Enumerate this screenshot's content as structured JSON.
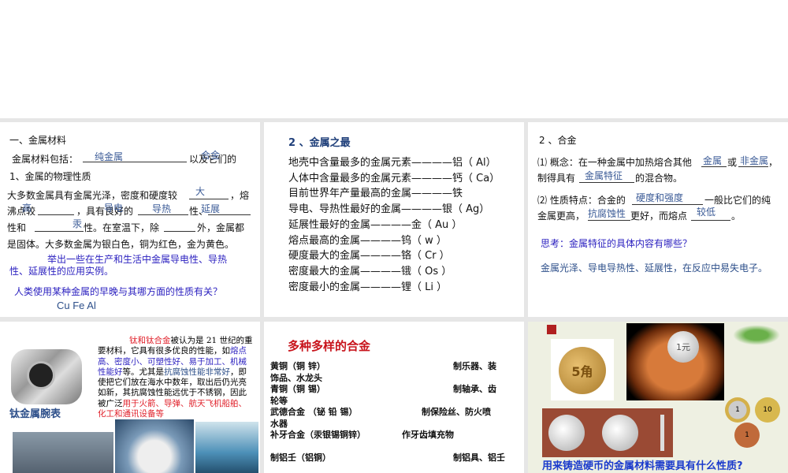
{
  "panel1": {
    "heading": "一、金属材料",
    "line1": "金属材料包括：",
    "line1_end": "以及它们的",
    "ans_pure": "纯金属",
    "ans_alloy": "合金",
    "sub": "1、金属的物理性质",
    "p1": "大多数金属具有金属光泽，密度和硬度较",
    "p1_end": "，熔",
    "p2a": "沸点较",
    "p2b": "，具有良好的",
    "p2c": "性、",
    "p3a": "性和",
    "p3b": "性。在室温下，除",
    "p3c": "外，金属都",
    "p4": "是固体。大多数金属为银白色，铜为红色，金为黄色。",
    "ans_big": "大",
    "ans_high": "高",
    "ans_elec": "导电",
    "ans_heat": "导热",
    "ans_duct": "延展",
    "ans_hg": "汞",
    "q1a": "举出一些在生产和生活中金属导电性、导热",
    "q1b": "性、延展性的应用实例。",
    "q2": "人类使用某种金属的早晚与其哪方面的性质有关？",
    "metals": "Cu   Fe   Al"
  },
  "panel2": {
    "heading": "2 、金属之最",
    "items": [
      "地壳中含量最多的金属元素————铝（ Al）",
      "人体中含量最多的金属元素————钙（ Ca）",
      "目前世界年产量最高的金属————铁",
      "导电、导热性最好的金属————银（ Ag）",
      "延展性最好的金属————金（ Au ）",
      "熔点最高的金属————钨（ w ）",
      "硬度最大的金属————铬（ Cr ）",
      "密度最大的金属————锇（ Os ）",
      "密度最小的金属————锂（ Li ）"
    ]
  },
  "panel3": {
    "heading": "2 、合金",
    "c1a": "⑴ 概念：在一种金属中加热熔合其他",
    "c1b": "或",
    "c1c": "，",
    "c2a": "制得具有",
    "c2b": "的混合物。",
    "ans_metal": "金属",
    "ans_nonmetal": "非金属",
    "ans_feature": "金属特征",
    "p1a": "⑵ 性质特点：合金的",
    "p1b": "一般比它们的纯",
    "p2a": "金属更高，",
    "p2b": "更好，而熔点",
    "p2c": "。",
    "ans_hard": "硬度和强度",
    "ans_corr": "抗腐蚀性",
    "ans_low": "较低",
    "think": "思考：金属特征的具体内容有哪些？",
    "answer": "金属光泽、导电导热性、延展性，在反应中易失电子。"
  },
  "panel4": {
    "caption": "钛金属腕表",
    "t_red1": "钛和钛合金",
    "t1": "被认为是 21 世纪的重",
    "t2": "要材料，它具有很多优良的性能，如",
    "t_blue1": "熔点",
    "t_blue2": "高、密度小、可塑性好、易于加工、机械",
    "t_blue3": "性能好",
    "t3": "等。尤其是",
    "t_blue4": "抗腐蚀性能非常好",
    "t3b": "，即",
    "t4": "使把它们放在海水中数年，取出后仍光亮",
    "t5": "如新，其抗腐蚀性能远优于不锈钢，因此",
    "t6": "被广泛",
    "t_red2": "用于火箭、导弹、航天飞机船舶、",
    "t_red3": "化工和通讯设备等"
  },
  "panel5": {
    "title": "多种多样的合金",
    "rows": [
      {
        "name": "黄铜（铜 锌）",
        "use": "制乐器、装",
        "cont": "饰品、水龙头"
      },
      {
        "name": "青铜（铜  锡）",
        "use": "制轴承、齿",
        "cont": "轮等"
      },
      {
        "name": "武德合金 （铋 铅 锡）",
        "use": "制保险丝、防火喷",
        "cont": "水器"
      },
      {
        "name": "补牙合金（汞银锡铜锌）",
        "use": "作牙齿填充物",
        "cont": ""
      },
      {
        "name": "制铝壬（铝铜）",
        "use": "制铝具、铝壬",
        "cont": ""
      }
    ]
  },
  "panel6": {
    "question": "用来铸造硬币的金属材料需要具有什么性质?",
    "coin_5": "5角",
    "coin_1": "1元",
    "euro_1": "1",
    "euro_10": "10",
    "euro_c": "1"
  }
}
